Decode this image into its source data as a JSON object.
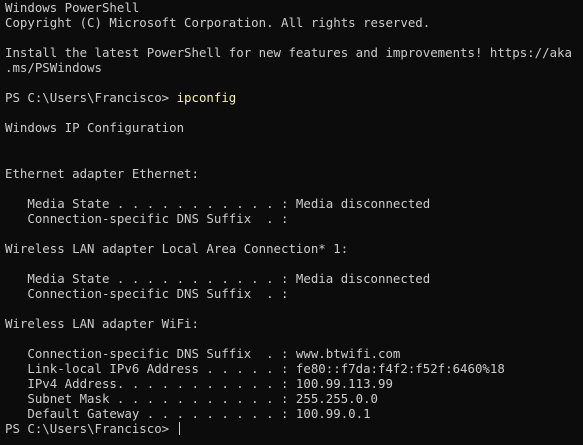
{
  "window": {
    "title": "Windows PowerShell"
  },
  "terminal": {
    "header_title": "Windows PowerShell",
    "copyright": "Copyright (C) Microsoft Corporation. All rights reserved.",
    "install_msg_line1": "Install the latest PowerShell for new features and improvements! https://aka",
    "install_msg_line2": ".ms/PSWindows",
    "prompt1": "PS C:\\Users\\Francisco> ",
    "command": "ipconfig",
    "ip_config_title": "Windows IP Configuration",
    "adapters": [
      {
        "header": "Ethernet adapter Ethernet:",
        "lines": [
          "   Media State . . . . . . . . . . . : Media disconnected",
          "   Connection-specific DNS Suffix  . :"
        ]
      },
      {
        "header": "Wireless LAN adapter Local Area Connection* 1:",
        "lines": [
          "   Media State . . . . . . . . . . . : Media disconnected",
          "   Connection-specific DNS Suffix  . :"
        ]
      },
      {
        "header": "Wireless LAN adapter WiFi:",
        "lines": [
          "   Connection-specific DNS Suffix  . : www.btwifi.com",
          "   Link-local IPv6 Address . . . . . : fe80::f7da:f4f2:f52f:6460%18",
          "   IPv4 Address. . . . . . . . . . . : 100.99.113.99",
          "   Subnet Mask . . . . . . . . . . . : 255.255.0.0",
          "   Default Gateway . . . . . . . . . : 100.99.0.1"
        ]
      }
    ],
    "prompt2": "PS C:\\Users\\Francisco> "
  },
  "colors": {
    "background": "#0c0c0c",
    "foreground": "#cccccc",
    "command": "#f9f1a5"
  }
}
